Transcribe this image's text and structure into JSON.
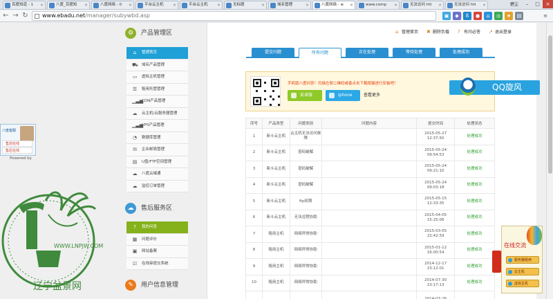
{
  "browser": {
    "tabs": [
      {
        "label": "百度知道 - 1",
        "active": false
      },
      {
        "label": "八度_百度知",
        "active": false
      },
      {
        "label": "八度网络 - 0",
        "active": false
      },
      {
        "label": "平台云主机",
        "active": false
      },
      {
        "label": "平台云主机",
        "active": false
      },
      {
        "label": "无标题",
        "active": false
      },
      {
        "label": "域名管理",
        "active": false
      },
      {
        "label": "八度网络 - ≡",
        "active": true
      },
      {
        "label": "www.comp",
        "active": false
      },
      {
        "label": "无法访问 htt",
        "active": false
      },
      {
        "label": "无法访问 htt",
        "active": false
      }
    ],
    "user": "碧尘",
    "url_host": "www.ebadu.net",
    "url_path": "/manager/subywbd.asp"
  },
  "sidebar": {
    "product_title": "产品管理区",
    "product_items": [
      {
        "label": "管理首页",
        "icon": "home-icon",
        "active": true
      },
      {
        "label": "域名产品管理",
        "icon": "cart-icon"
      },
      {
        "label": "虚拟主机管理",
        "icon": "monitor-icon"
      },
      {
        "label": "租用托管管理",
        "icon": "list-icon"
      },
      {
        "label": "CDN产品管理",
        "icon": "signal-icon"
      },
      {
        "label": "云主机/云服务器管理",
        "icon": "cloud-icon"
      },
      {
        "label": "VPS产品管理",
        "icon": "signal-icon"
      },
      {
        "label": "数据库管理",
        "icon": "pie-icon"
      },
      {
        "label": "企业邮局管理",
        "icon": "mail-icon"
      },
      {
        "label": "U盘/FTP空间管理",
        "icon": "disk-icon"
      },
      {
        "label": "八度云储通",
        "icon": "cloud-icon"
      },
      {
        "label": "监控订单管理",
        "icon": "cloud-icon"
      }
    ],
    "service_title": "售后服务区",
    "service_items": [
      {
        "label": "我的问答",
        "icon": "question-icon",
        "active": true
      },
      {
        "label": "问题评价",
        "icon": "comment-icon"
      },
      {
        "label": "网站备案",
        "icon": "record-icon"
      },
      {
        "label": "在线审提交系统",
        "icon": "check-icon"
      }
    ],
    "info_title": "用户信息管理"
  },
  "toplinks": [
    {
      "label": "管理首页",
      "icon": "home-icon"
    },
    {
      "label": "删除负载",
      "icon": "trash-icon"
    },
    {
      "label": "有问必答",
      "icon": "question-icon"
    },
    {
      "label": "退出登录",
      "icon": "logout-icon"
    }
  ],
  "question_tabs": [
    {
      "label": "提交问题",
      "active": false
    },
    {
      "label": "所有问题",
      "active": true
    },
    {
      "label": "正在处理",
      "active": false
    },
    {
      "label": "等待处理",
      "active": false
    },
    {
      "label": "处理成功",
      "active": false
    }
  ],
  "promo": {
    "text": "手机版八度问答！扫描左侧二维码或者点击下载按键进行安装吧！",
    "android_label": "安卓版",
    "iphone_label": "iphone",
    "more_label": "查看更多"
  },
  "table": {
    "headers": [
      "序号",
      "产品类型",
      "问题类别",
      "问题内容",
      "提交时间",
      "处理状态"
    ],
    "rows": [
      {
        "no": "1",
        "type": "新斗云主机",
        "category": "云主机无法访问故障",
        "content": "",
        "time": "2015-05-27 12:37:50",
        "status": "处理成功"
      },
      {
        "no": "2",
        "type": "新斗云主机",
        "category": "密码破解",
        "content": "",
        "time": "2015-05-24 09:54:53",
        "status": "处理成功"
      },
      {
        "no": "3",
        "type": "新斗云主机",
        "category": "密码破解",
        "content": "",
        "time": "2015-05-24 09:21:10",
        "status": "处理成功"
      },
      {
        "no": "4",
        "type": "新斗云主机",
        "category": "密码破解",
        "content": "",
        "time": "2015-05-24 09:03:18",
        "status": "处理成功"
      },
      {
        "no": "5",
        "type": "新斗云主机",
        "category": "ftp权限",
        "content": "",
        "time": "2015-05-15 12:33:35",
        "status": "处理成功"
      },
      {
        "no": "6",
        "type": "新斗云主机",
        "category": "无法远程协助",
        "content": "",
        "time": "2015-04-05 15:25:06",
        "status": "处理成功"
      },
      {
        "no": "7",
        "type": "租用主机",
        "category": "网络异常协助",
        "content": "",
        "time": "2015-03-05 22:42:59",
        "status": "处理成功"
      },
      {
        "no": "8",
        "type": "租用主机",
        "category": "网络异常协助",
        "content": "",
        "time": "2015-01-12 16:00:54",
        "status": "处理成功"
      },
      {
        "no": "9",
        "type": "租用主机",
        "category": "网络异常协助",
        "content": "",
        "time": "2014-12-17 23:12:01",
        "status": "处理成功"
      },
      {
        "no": "10",
        "type": "租用主机",
        "category": "网络异常协助",
        "content": "",
        "time": "2014-07-30 23:17:13",
        "status": "处理成功"
      },
      {
        "no": "",
        "type": "",
        "category": "",
        "content": "",
        "time": "2014-07-26",
        "status": ""
      }
    ]
  },
  "qq_label": "QQ旋风",
  "float_left": {
    "header": "八度客服",
    "online": "售前在线",
    "after": "售后在线",
    "powered": "Powered by"
  },
  "float_right": {
    "title": "在线交流",
    "buttons": [
      "服务器租用",
      "云主机",
      "虚拟主机"
    ]
  },
  "watermark": {
    "url": "WWW.LNPJW.COM",
    "text": "辽宁盆景网"
  },
  "colors": {
    "accent": "#1fa0d6",
    "green": "#85b11a",
    "status_ok": "#2e9e2e",
    "promo": "#e6400a"
  }
}
